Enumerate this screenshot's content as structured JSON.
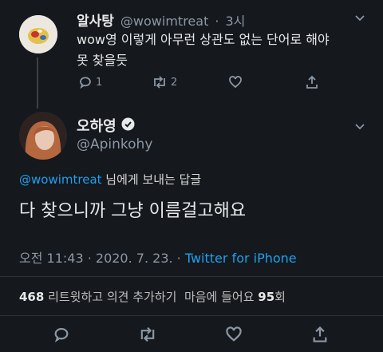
{
  "parent_tweet": {
    "display_name": "알사탕",
    "handle": "@wowimtreat",
    "separator": "·",
    "time": "3시",
    "text_line1": "wow영 이렇게 아무런 상관도 없는 단어로 해야",
    "text_line2": "못 찾을듯",
    "reply_count": "1",
    "retweet_count": "2"
  },
  "main_tweet": {
    "display_name": "오하영",
    "handle": "@Apinkohy",
    "replying_to_handle": "@wowimtreat",
    "replying_to_suffix": " 님에게 보내는 답글",
    "text": "다 찾으니까 그냥 이름걸고해요",
    "time": "오전 11:43 · 2020. 7. 23. · ",
    "source": "Twitter for iPhone",
    "retweet_quote_count": "468",
    "retweet_quote_label": " 리트윗하고 의견 추가하기  마음에 들어요 ",
    "like_count": "95",
    "like_suffix": "회"
  },
  "colors": {
    "background": "#15181c",
    "accent": "#1da1f2",
    "muted": "#8b98a5",
    "verified_badge": "#e7e9ea"
  },
  "icons": [
    "chevron-down-icon",
    "reply-icon",
    "retweet-icon",
    "like-icon",
    "share-icon",
    "verified-badge-icon"
  ]
}
